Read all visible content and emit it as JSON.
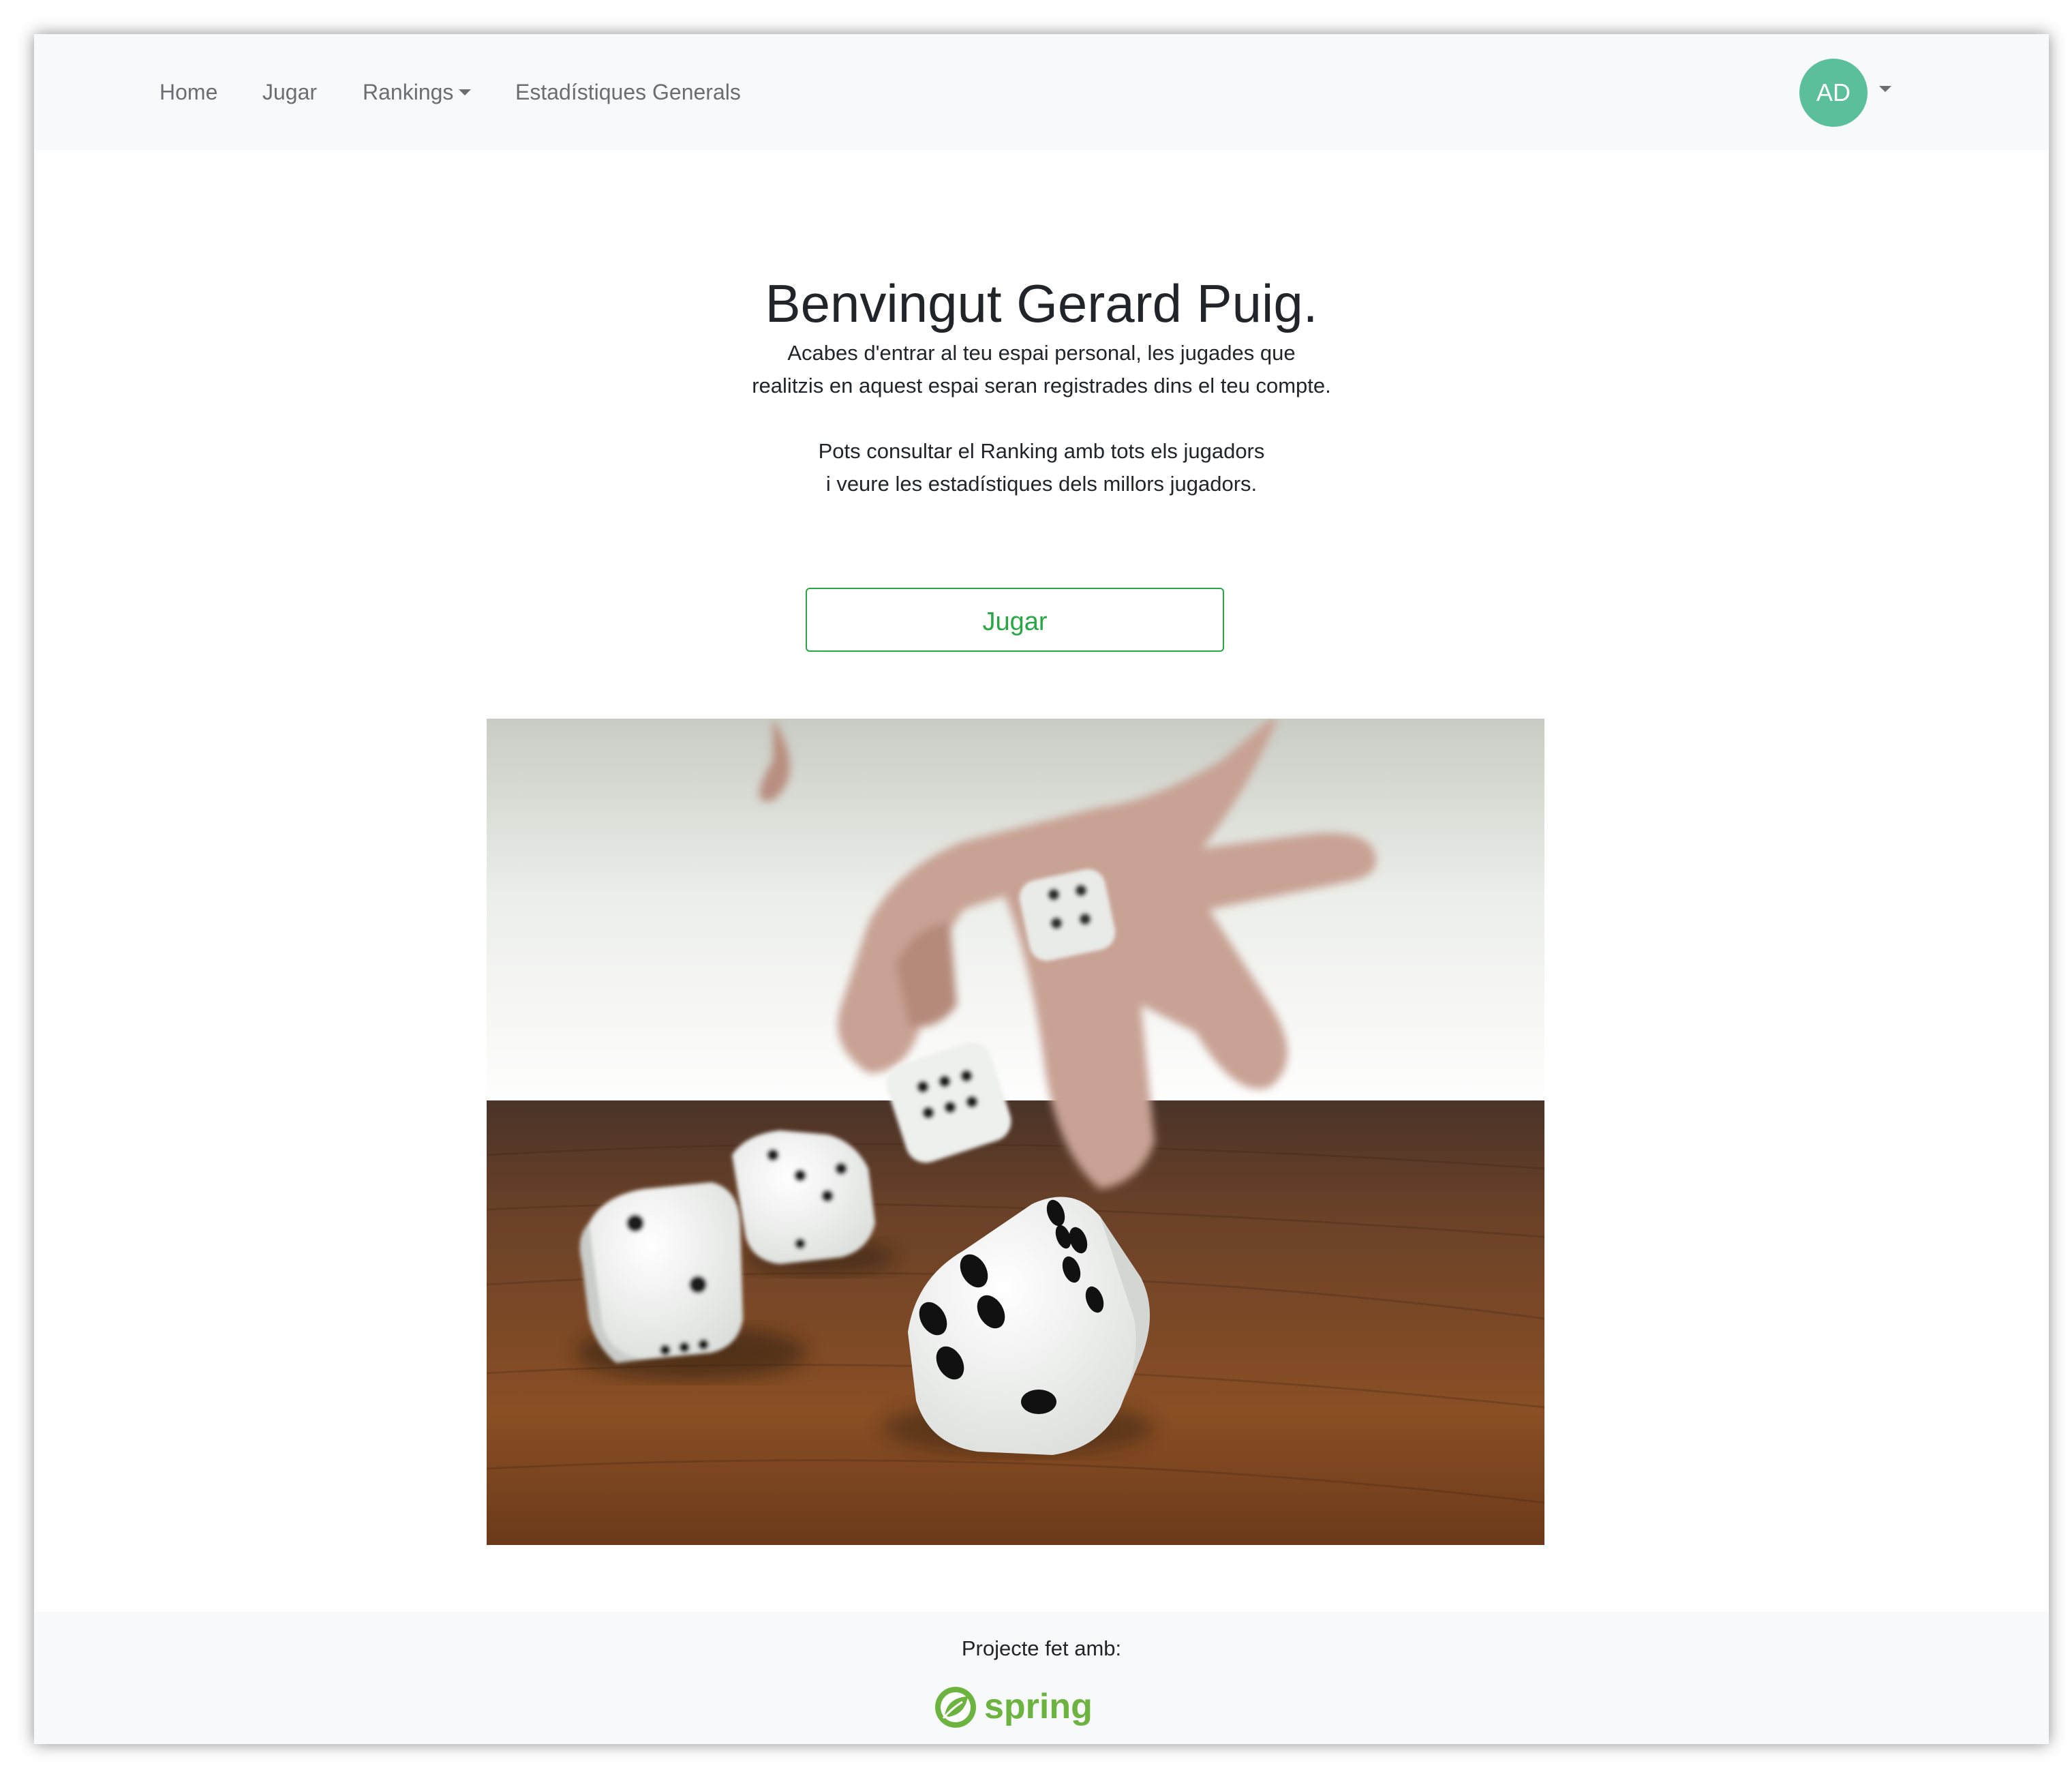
{
  "navbar": {
    "items": [
      {
        "label": "Home"
      },
      {
        "label": "Jugar"
      },
      {
        "label": "Rankings"
      },
      {
        "label": "Estadístiques Generals"
      }
    ],
    "avatar_initials": "AD",
    "avatar_color": "#5cbf9c"
  },
  "main": {
    "title": "Benvingut Gerard Puig.",
    "paragraph1": [
      "Acabes d'entrar al teu espai personal, les jugades que",
      "realitzis en aquest espai seran registrades dins el teu compte."
    ],
    "paragraph2": [
      "Pots consultar el Ranking amb tots els jugadors",
      "i veure les estadístiques dels millors jugadors."
    ],
    "play_button_label": "Jugar",
    "accent_color": "#28a745"
  },
  "footer": {
    "text": "Projecte fet amb:",
    "logo_text": "spring",
    "logo_color": "#6db33f"
  }
}
